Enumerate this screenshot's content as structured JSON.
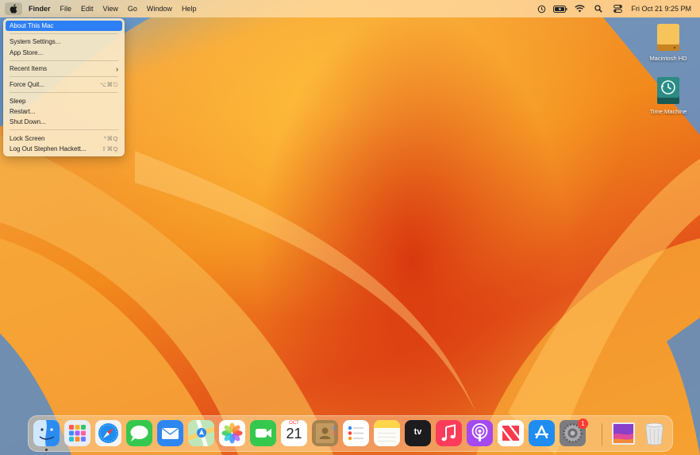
{
  "menubar": {
    "items": [
      "Finder",
      "File",
      "Edit",
      "View",
      "Go",
      "Window",
      "Help"
    ],
    "status_icons": [
      "time-machine-icon",
      "battery-icon",
      "wifi-icon",
      "spotlight-icon",
      "control-center-icon"
    ],
    "clock": "Fri Oct 21  9:25 PM"
  },
  "apple_menu": {
    "about": "About This Mac",
    "system_settings": "System Settings...",
    "app_store": "App Store...",
    "recent_items": "Recent Items",
    "force_quit": "Force Quit...",
    "force_quit_shortcut": "⌥⌘⎋",
    "sleep": "Sleep",
    "restart": "Restart...",
    "shut_down": "Shut Down...",
    "lock_screen": "Lock Screen",
    "lock_screen_shortcut": "^⌘Q",
    "log_out": "Log Out Stephen Hackett...",
    "log_out_shortcut": "⇧⌘Q"
  },
  "desktop": {
    "macintosh_hd": "Macintosh HD",
    "time_machine": "Time Machine"
  },
  "dock": {
    "apps": [
      "finder",
      "launchpad",
      "safari",
      "messages",
      "mail",
      "maps",
      "photos",
      "facetime",
      "calendar",
      "contacts",
      "reminders",
      "notes",
      "tv",
      "music",
      "podcasts",
      "news",
      "app-store",
      "system-settings"
    ],
    "calendar_month": "OCT",
    "calendar_day": "21",
    "tv_label": "tv",
    "settings_badge": "1"
  },
  "colors": {
    "accent": "#2d7ff4",
    "wallpaper_orange": "#f28a1c",
    "wallpaper_red": "#d9380f",
    "wallpaper_blue": "#6aa2d6"
  }
}
